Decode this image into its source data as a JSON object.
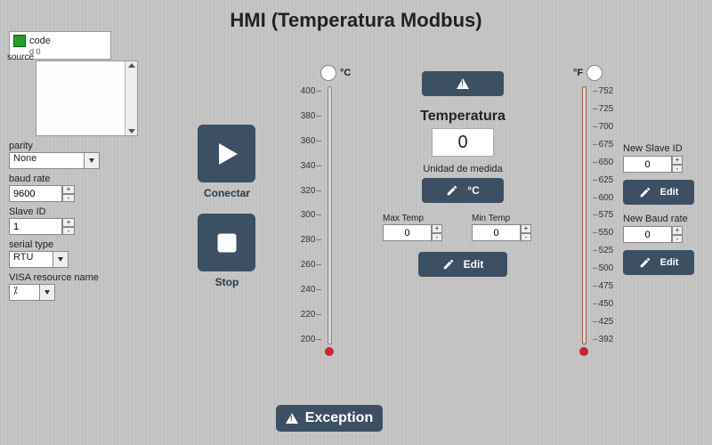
{
  "title": "HMI (Temperatura Modbus)",
  "config": {
    "code_label": "code",
    "code_sub": "d 0",
    "source_label": "source",
    "parity_label": "parity",
    "parity_value": "None",
    "baud_label": "baud rate",
    "baud_value": "9600",
    "slave_label": "Slave ID",
    "slave_value": "1",
    "serial_label": "serial type",
    "serial_value": "RTU",
    "visa_label": "VISA resource name",
    "visa_value": "⁒"
  },
  "buttons": {
    "conectar": "Conectar",
    "stop": "Stop",
    "exception": "Exception",
    "edit": "Edit"
  },
  "therm_c": {
    "unit": "°C",
    "ticks": [
      "400",
      "380",
      "360",
      "340",
      "320",
      "300",
      "280",
      "260",
      "240",
      "220",
      "200"
    ]
  },
  "therm_f": {
    "unit": "°F",
    "ticks": [
      "752",
      "725",
      "700",
      "675",
      "650",
      "625",
      "600",
      "575",
      "550",
      "525",
      "500",
      "475",
      "450",
      "425",
      "392"
    ]
  },
  "center": {
    "temp_label": "Temperatura",
    "temp_value": "0",
    "unit_label": "Unidad de medida",
    "unit_value": "°C",
    "max_label": "Max Temp",
    "max_value": "0",
    "min_label": "Min Temp",
    "min_value": "0"
  },
  "right": {
    "slave_label": "New Slave ID",
    "slave_value": "0",
    "baud_label": "New Baud rate",
    "baud_value": "0"
  }
}
